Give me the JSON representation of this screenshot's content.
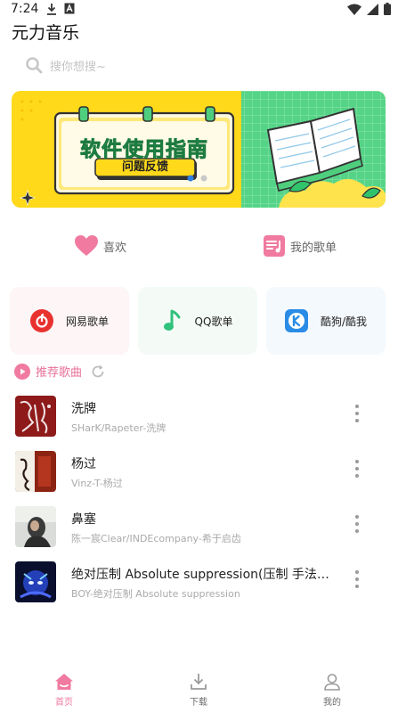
{
  "status_bar": {
    "time": "7:24",
    "icons": [
      "download-icon",
      "a-badge-icon",
      "wifi-icon",
      "signal-icon",
      "battery-icon"
    ]
  },
  "app": {
    "title": "元力音乐"
  },
  "search": {
    "placeholder": "搜你想搜~"
  },
  "banner": {
    "heading": "软件使用指南",
    "subheading": "问题反馈",
    "page_count": 2,
    "active_page": 1,
    "colors": {
      "yellow": "#ffd91a",
      "green": "#4fce7e",
      "accent": "#31c36b"
    }
  },
  "quick_links": [
    {
      "label": "喜欢",
      "icon": "heart-icon"
    },
    {
      "label": "我的歌单",
      "icon": "playlist-icon"
    }
  ],
  "sources": [
    {
      "label": "网易歌单",
      "icon": "netease-icon",
      "bg": "#fdf5f6"
    },
    {
      "label": "QQ歌单",
      "icon": "qq-music-icon",
      "bg": "#f4fbf7"
    },
    {
      "label": "酷狗/酷我",
      "icon": "kugou-icon",
      "bg": "#f4f9fd"
    }
  ],
  "recommend": {
    "title": "推荐歌曲",
    "accent": "#e8719a"
  },
  "songs": [
    {
      "title": "洗牌",
      "artist": "SHarK/Rapeter-洗牌"
    },
    {
      "title": "杨过",
      "artist": "Vinz-T-杨过"
    },
    {
      "title": "鼻塞",
      "artist": "陈一宸Clear/INDEcompany-希于启齿"
    },
    {
      "title": "绝对压制 Absolute suppression(压制 手法…",
      "artist": "BOY-绝对压制 Absolute suppression"
    }
  ],
  "tabs": [
    {
      "label": "首页",
      "icon": "home-icon",
      "active": true
    },
    {
      "label": "下载",
      "icon": "download-icon",
      "active": false
    },
    {
      "label": "我的",
      "icon": "user-icon",
      "active": false
    }
  ],
  "colors": {
    "pink": "#f07aa0",
    "inactive": "#9a9a9a"
  }
}
